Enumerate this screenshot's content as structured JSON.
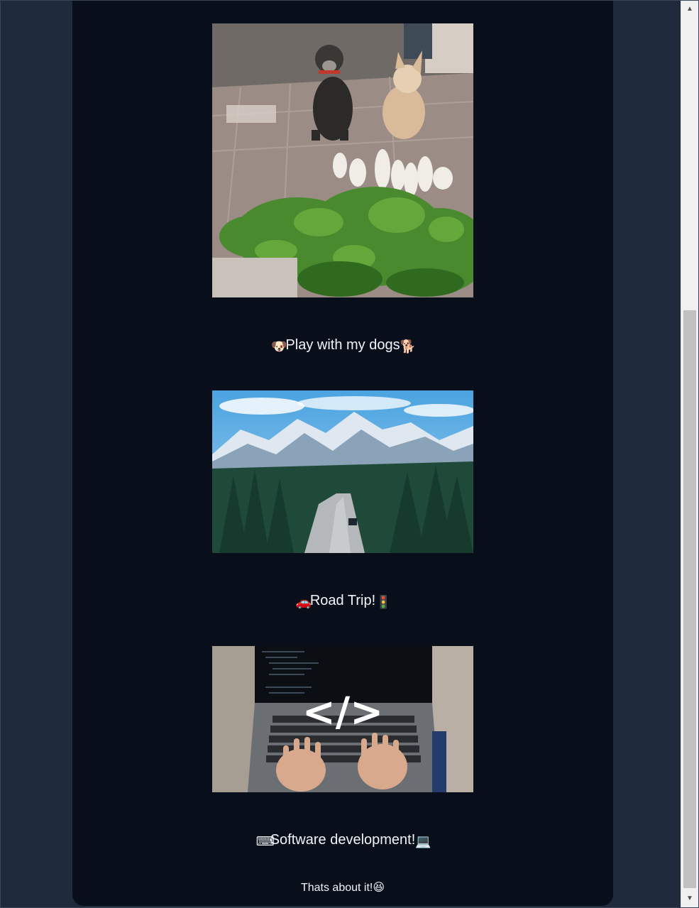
{
  "sections": [
    {
      "image_alt": "two dogs sitting behind harvested radishes",
      "caption_prefix_icon": "🐶",
      "caption": "Play with my dogs",
      "caption_suffix_icon": "🐕"
    },
    {
      "image_alt": "road through forest toward snowy mountains",
      "caption_prefix_icon": "🚗",
      "caption": "Road Trip!",
      "caption_suffix_icon": "🚦"
    },
    {
      "image_alt": "hands typing on a laptop with code symbol",
      "caption_prefix_icon": "⌨",
      "caption": "Software development!",
      "caption_suffix_icon": "💻"
    }
  ],
  "footer": {
    "text": "Thats about it!",
    "icon": "😆"
  },
  "colors": {
    "page_bg": "#1f2a3c",
    "card_bg": "#080e1a",
    "text": "#f1f5f9"
  }
}
